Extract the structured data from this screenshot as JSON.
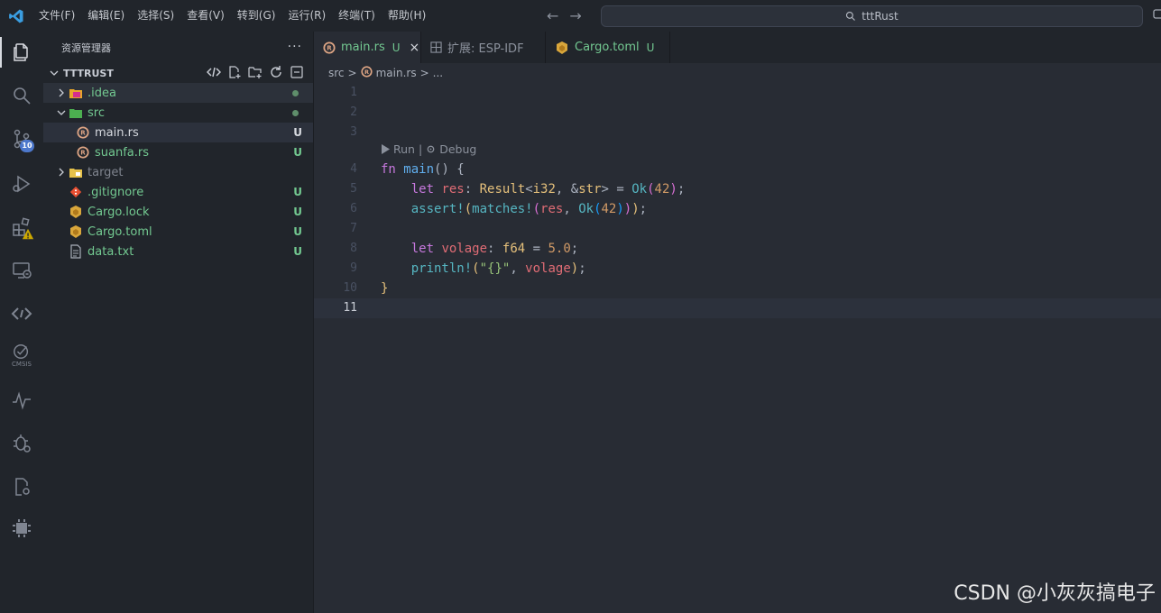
{
  "menu": [
    "文件(F)",
    "编辑(E)",
    "选择(S)",
    "查看(V)",
    "转到(G)",
    "运行(R)",
    "终端(T)",
    "帮助(H)"
  ],
  "search": {
    "text": "tttRust"
  },
  "activity": {
    "scm_badge": "10",
    "cmsis_label": "CMSIS"
  },
  "sidebar": {
    "title": "资源管理器",
    "more": "···",
    "project": "TTTRUST",
    "items": [
      {
        "label": ".idea",
        "status": ""
      },
      {
        "label": "src",
        "status": ""
      },
      {
        "label": "main.rs",
        "status": "U"
      },
      {
        "label": "suanfa.rs",
        "status": "U"
      },
      {
        "label": "target",
        "status": ""
      },
      {
        "label": ".gitignore",
        "status": "U"
      },
      {
        "label": "Cargo.lock",
        "status": "U"
      },
      {
        "label": "Cargo.toml",
        "status": "U"
      },
      {
        "label": "data.txt",
        "status": "U"
      }
    ]
  },
  "tabs": [
    {
      "label": "main.rs",
      "status": "U",
      "close": "×"
    },
    {
      "label": "扩展: ESP-IDF"
    },
    {
      "label": "Cargo.toml",
      "status": "U"
    }
  ],
  "breadcrumb": {
    "part1": "src",
    "sep1": ">",
    "part2": "main.rs",
    "sep2": ">",
    "part3": "..."
  },
  "editor": {
    "line_numbers": [
      "1",
      "2",
      "3",
      "4",
      "5",
      "6",
      "7",
      "8",
      "9",
      "10",
      "11"
    ],
    "codelens_run": "Run",
    "codelens_sep": "|",
    "codelens_debug": "Debug"
  },
  "watermark": "CSDN @小灰灰搞电子",
  "colors": {
    "accent": "#4d78cc",
    "untracked": "#73c991",
    "warning": "#cca700"
  }
}
